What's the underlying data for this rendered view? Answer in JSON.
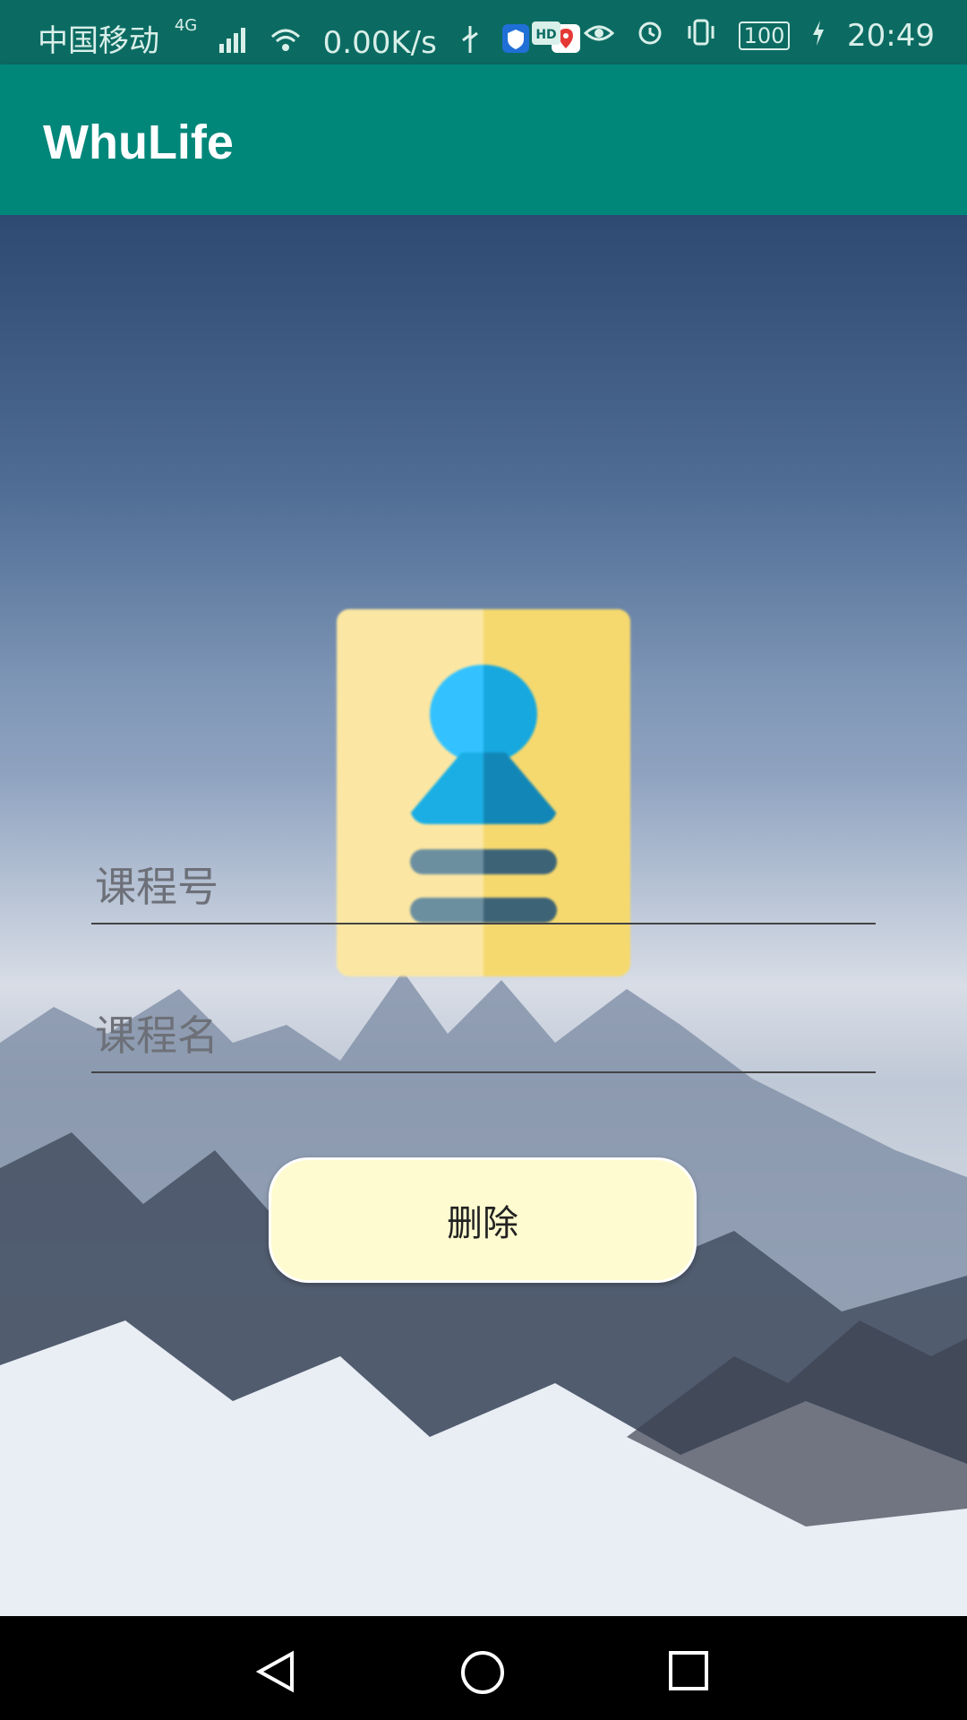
{
  "status_bar": {
    "carrier": "中国移动",
    "network": "4G",
    "speed": "0.00K/s",
    "battery": "100",
    "time": "20:49",
    "icons": [
      "signal-icon",
      "wifi-icon",
      "usb-icon",
      "shield-icon",
      "map-icon",
      "hd-icon",
      "eye-icon",
      "alarm-icon",
      "vibrate-icon",
      "battery-icon",
      "charging-icon"
    ]
  },
  "app_bar": {
    "title": "WhuLife"
  },
  "form": {
    "course_id_placeholder": "课程号",
    "course_name_placeholder": "课程名",
    "delete_label": "删除"
  },
  "nav": {
    "icons": [
      "back-icon",
      "home-icon",
      "recents-icon"
    ]
  }
}
